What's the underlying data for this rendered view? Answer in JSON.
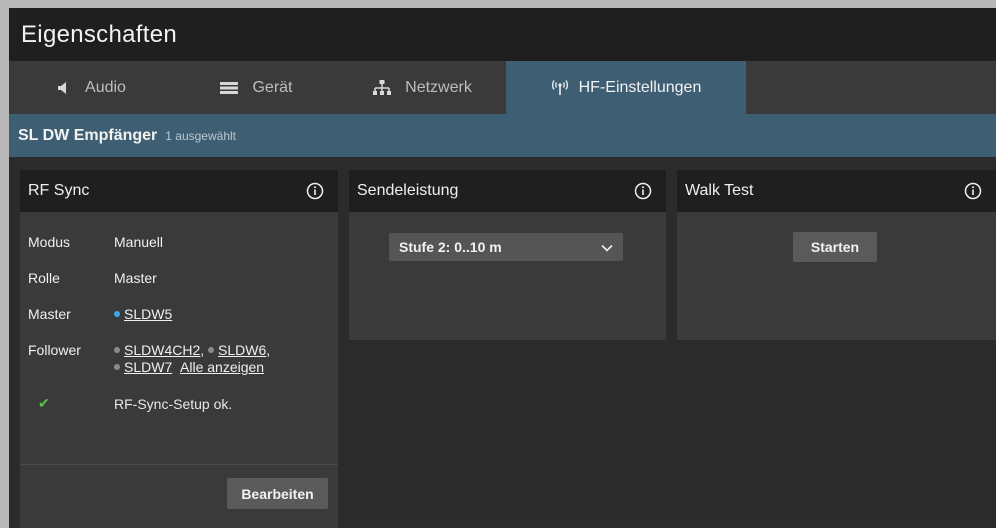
{
  "window": {
    "title": "Eigenschaften"
  },
  "tabs": [
    {
      "label": "Audio",
      "icon": "speaker-icon",
      "active": false
    },
    {
      "label": "Gerät",
      "icon": "device-icon",
      "active": false
    },
    {
      "label": "Netzwerk",
      "icon": "network-icon",
      "active": false
    },
    {
      "label": "HF-Einstellungen",
      "icon": "antenna-icon",
      "active": true
    }
  ],
  "device": {
    "name": "SL DW Empfänger",
    "selection": "1 ausgewählt"
  },
  "rf_sync": {
    "title": "RF Sync",
    "rows": [
      {
        "label": "Modus",
        "value": "Manuell"
      },
      {
        "label": "Rolle",
        "value": "Master"
      }
    ],
    "master_label": "Master",
    "master_device": "SLDW5",
    "follower_label": "Follower",
    "followers": [
      "SLDW4CH2",
      "SLDW6",
      "SLDW7"
    ],
    "show_all": "Alle anzeigen",
    "status": "RF-Sync-Setup ok.",
    "edit_button": "Bearbeiten"
  },
  "transmit_power": {
    "title": "Sendeleistung",
    "selected": "Stufe 2: 0..10 m"
  },
  "walk_test": {
    "title": "Walk Test",
    "start_button": "Starten"
  },
  "colors": {
    "accent": "#3e5f73",
    "master_dot": "#3fa8e6",
    "follower_dot": "#8c8c8c",
    "ok": "#5ac24a"
  }
}
